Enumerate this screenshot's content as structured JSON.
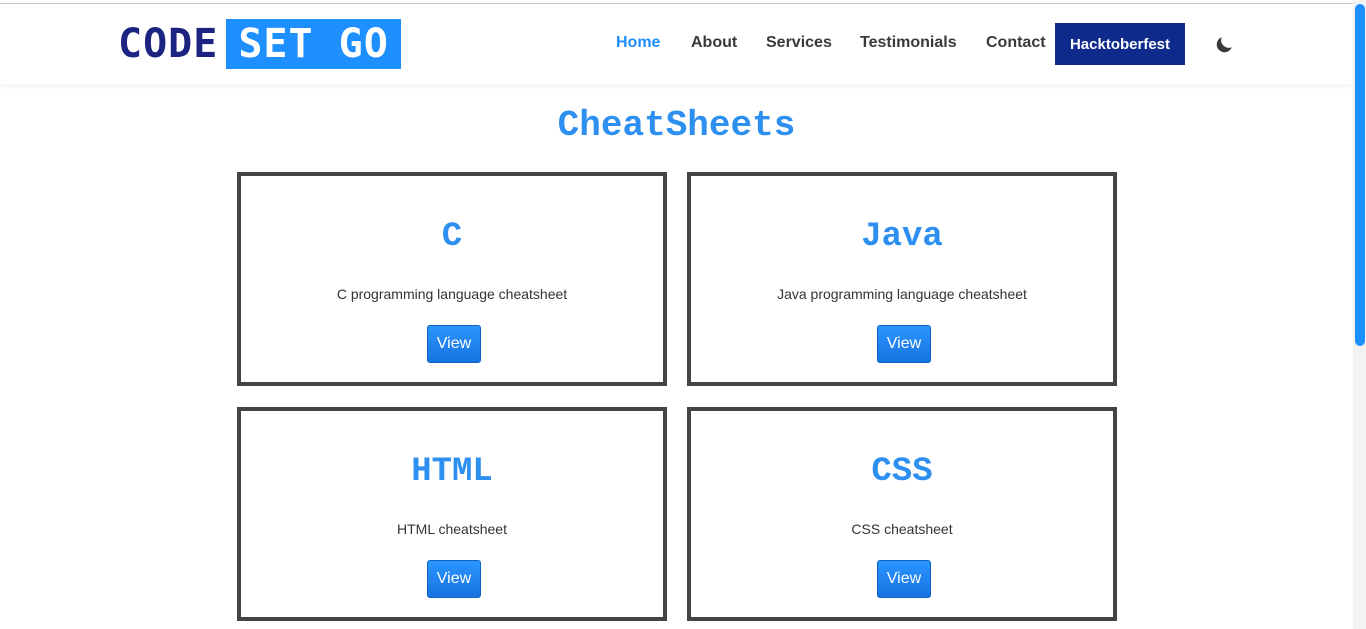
{
  "brand": {
    "code": "CODE",
    "setgo": "SET GO"
  },
  "nav": {
    "home": "Home",
    "about": "About",
    "services": "Services",
    "testimonials": "Testimonials",
    "contact": "Contact",
    "hacktoberfest": "Hacktoberfest"
  },
  "icons": {
    "theme_toggle": "moon-icon"
  },
  "page": {
    "title": "CheatSheets"
  },
  "cards": [
    {
      "title": "C",
      "description": "C programming language cheatsheet",
      "button": "View"
    },
    {
      "title": "Java",
      "description": "Java programming language cheatsheet",
      "button": "View"
    },
    {
      "title": "HTML",
      "description": "HTML cheatsheet",
      "button": "View"
    },
    {
      "title": "CSS",
      "description": "CSS cheatsheet",
      "button": "View"
    }
  ],
  "colors": {
    "accent": "#1e8fff",
    "brand_dark": "#1c2380",
    "hacktoberfest_bg": "#0e2a8a"
  }
}
